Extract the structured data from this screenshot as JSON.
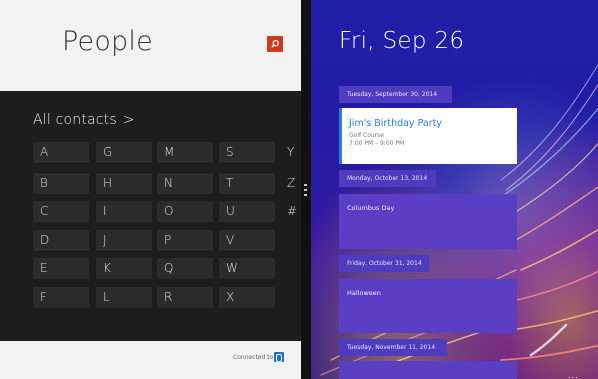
{
  "people": {
    "title": "People",
    "all_contacts_label": "All contacts",
    "all_contacts_chevron": ">",
    "letters": [
      "A",
      "B",
      "C",
      "D",
      "E",
      "F",
      "G",
      "H",
      "I",
      "J",
      "K",
      "L",
      "M",
      "N",
      "O",
      "P",
      "Q",
      "R",
      "S",
      "T",
      "U",
      "V",
      "W",
      "X",
      "Y",
      "Z",
      "#"
    ],
    "footer": {
      "connected_label": "Connected to",
      "service_icon": "outlook-icon"
    },
    "search_icon": "search-icon",
    "accent_color": "#d13b1d"
  },
  "calendar": {
    "date_title": "Fri, Sep 26",
    "days": [
      {
        "header": "Tuesday, September 30, 2014",
        "event": {
          "title": "Jim's Birthday Party",
          "location": "Golf Course",
          "time": "7:00 PM – 9:00 PM"
        }
      },
      {
        "header": "Monday, October 13, 2014",
        "event": {
          "title": "Columbus Day"
        }
      },
      {
        "header": "Friday, October 31, 2014",
        "event": {
          "title": "Halloween"
        }
      },
      {
        "header": "Tuesday, November 11, 2014"
      }
    ],
    "more_label": "...",
    "event_accent_color": "#2d7bd6"
  }
}
